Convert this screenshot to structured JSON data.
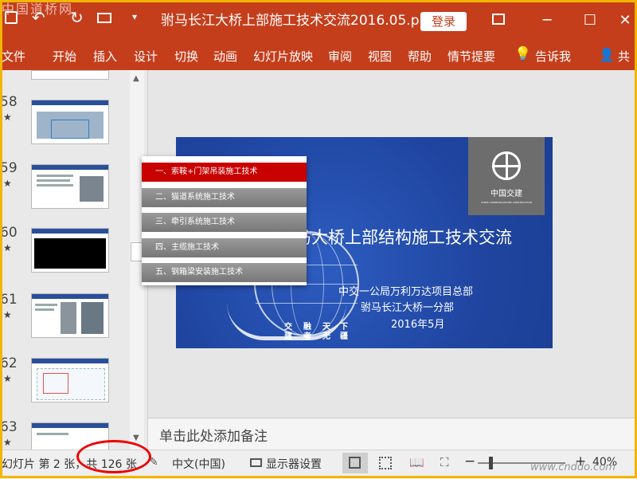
{
  "watermark": {
    "top": "中国道桥网",
    "bottom": "www.cnddo.com"
  },
  "titlebar": {
    "save_icon": "save-icon",
    "undo_icon": "undo-icon",
    "redo_icon": "redo-icon",
    "present_icon": "present-icon",
    "customize_icon": "customize-icon",
    "title": "驸马长江大桥上部施工技术交流2016.05.ppt...",
    "login": "登录",
    "restore_ribbon_icon": "ribbon-display-icon",
    "minimize": "─",
    "maximize": "☐",
    "close": "✕"
  },
  "ribbon": {
    "tabs": [
      "文件",
      "开始",
      "插入",
      "设计",
      "切换",
      "动画",
      "幻灯片放映",
      "审阅",
      "视图",
      "帮助",
      "情节提要"
    ],
    "tell_me": "告诉我",
    "share": "共"
  },
  "thumbnails": {
    "numbers": [
      "58",
      "59",
      "60",
      "61",
      "62",
      "63"
    ],
    "star": "★"
  },
  "slide": {
    "menu_items": [
      "一、索鞍+门架吊装施工技术",
      "二、猫道系统施工技术",
      "三、牵引系统施工技术",
      "四、主缆施工技术",
      "五、钢箱梁安装施工技术"
    ],
    "main_title": "马大桥上部结构施工技术交流",
    "sub_lines": [
      "中交一公局万利万达项目总部",
      "驸马长江大桥一分部",
      "2016年5月"
    ],
    "motto_row1": [
      "交",
      "融",
      "天",
      "下"
    ],
    "motto_row2": [
      "建",
      "者",
      "无",
      "疆"
    ],
    "logo_text": "中国交建",
    "logo_sub": "CHINA COMMUNICATIONS CONSTRUCTION"
  },
  "notes": {
    "placeholder": "单击此处添加备注"
  },
  "statusbar": {
    "slide_info": "幻灯片 第 2 张，共 126 张",
    "language": "中文(中国)",
    "display_settings": "显示器设置",
    "zoom_minus": "−",
    "zoom_plus": "+",
    "zoom": "40%"
  },
  "colors": {
    "accent": "#c43e1c",
    "slide_bg": "#2046a6",
    "active_menu": "#c80000"
  }
}
